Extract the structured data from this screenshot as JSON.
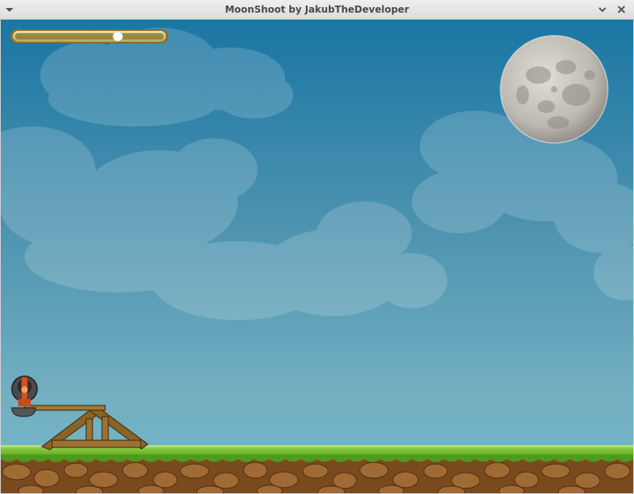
{
  "window": {
    "title": "MoonShoot by JakubTheDeveloper"
  },
  "hud": {
    "power_level": 0.7
  },
  "icons": {
    "menu": "chevron-down-icon",
    "minimize": "minimize-icon",
    "close": "close-icon"
  },
  "colors": {
    "sky_top": "#1d7aa6",
    "sky_bottom": "#7fb8c6",
    "grass": "#6cb52a",
    "dirt": "#7a4a1f",
    "wood": "#8a6327",
    "moon": "#c9c6bf"
  }
}
